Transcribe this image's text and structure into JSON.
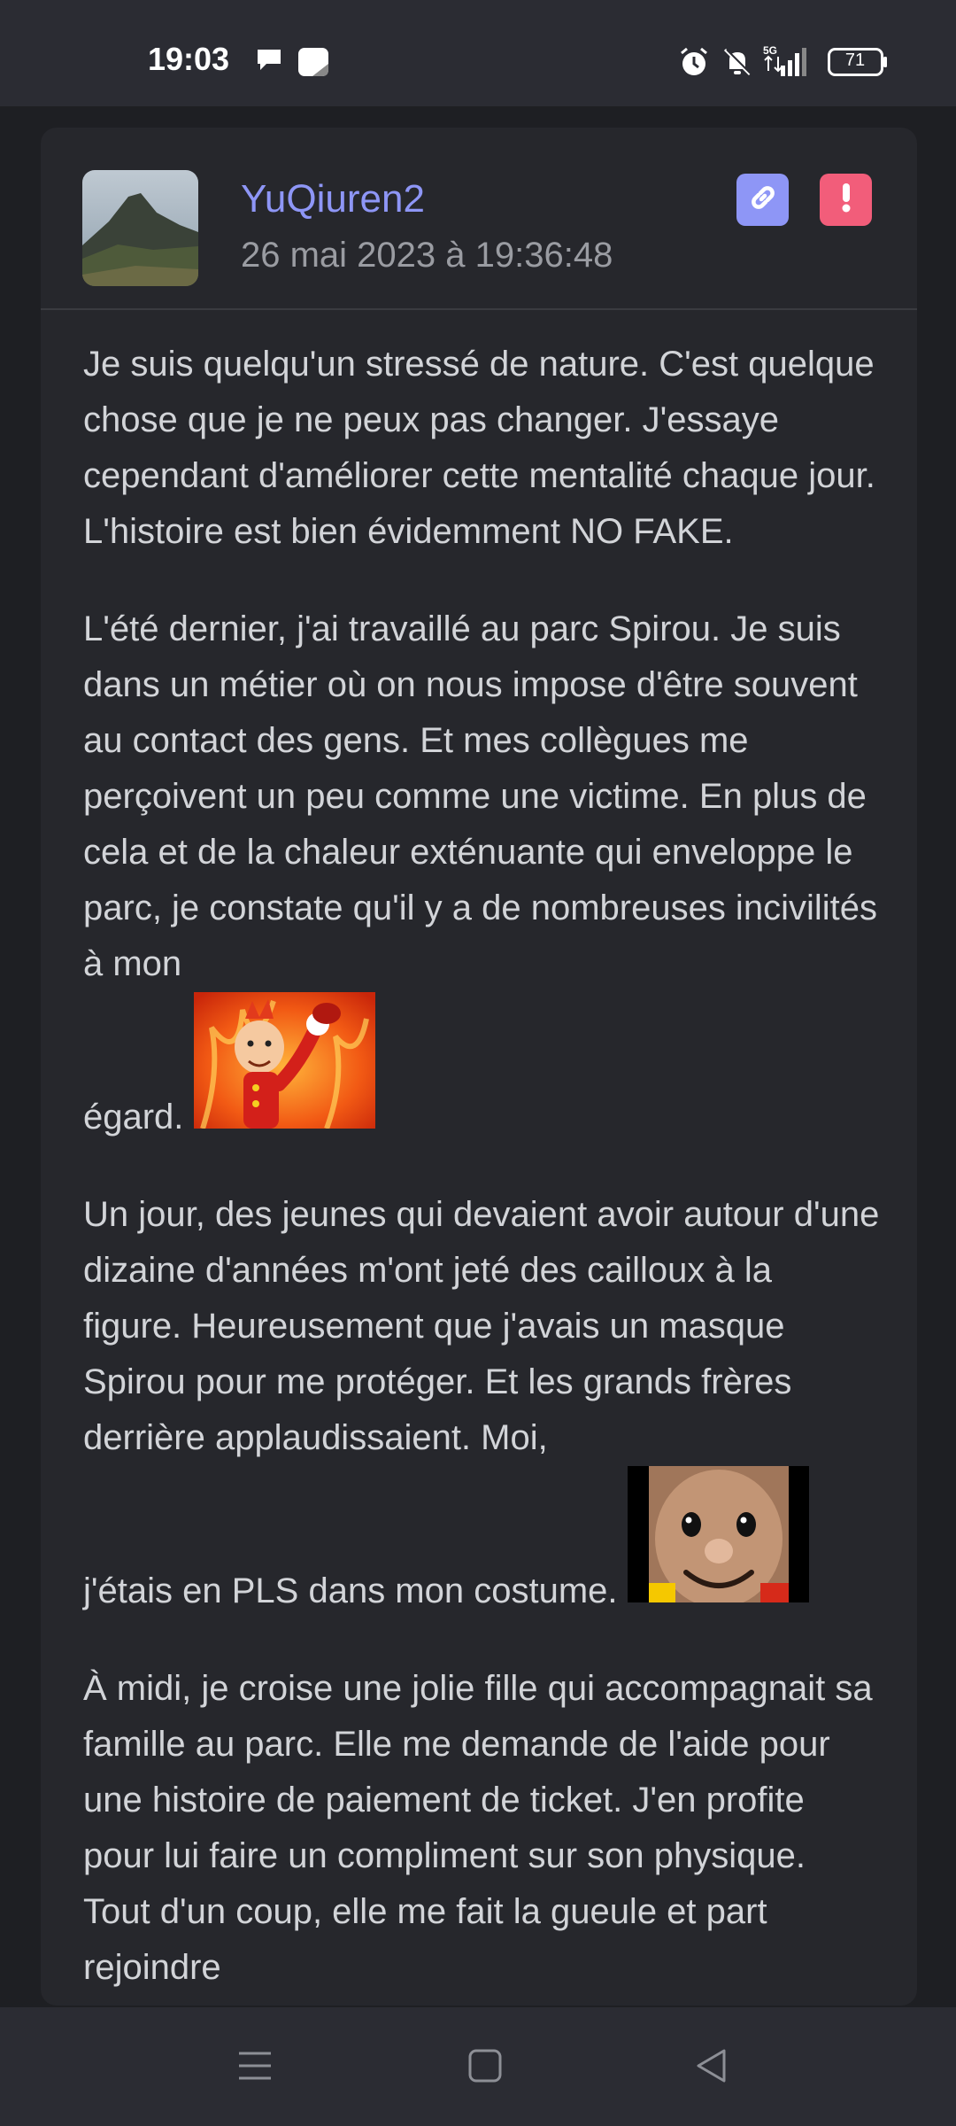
{
  "status_bar": {
    "time": "19:03",
    "battery": "71",
    "network": "5G",
    "icons": [
      "chat-bubble-icon",
      "app-notification-icon",
      "alarm-icon",
      "mute-icon",
      "signal-icon",
      "battery-icon"
    ]
  },
  "post": {
    "author": "YuQiuren2",
    "date": "26 mai 2023 à 19:36:48",
    "actions": [
      "link-icon",
      "report-icon"
    ],
    "paragraphs": [
      "Je suis quelqu'un stressé de nature. C'est quelque chose que je ne peux pas changer. J'essaye cependant d'améliorer cette mentalité chaque jour. L'histoire est bien évidemment NO FAKE.",
      "L'été dernier, j'ai travaillé au parc Spirou. Je suis dans un métier où on nous impose d'être souvent au contact des gens. Et mes collègues me perçoivent un peu comme une victime. En plus de cela et de la chaleur exténuante qui enveloppe le parc, je constate qu'il y a de nombreuses incivilités à mon",
      "égard.",
      "Un jour, des jeunes qui devaient avoir autour d'une dizaine d'années m'ont jeté des cailloux à la figure. Heureusement que j'avais un masque Spirou pour me protéger. Et les grands frères derrière applaudissaient. Moi,",
      "j'étais en PLS dans mon costume.",
      "À midi, je croise une jolie fille qui accompagnait sa famille au parc. Elle me demande de l'aide pour une histoire de paiement de ticket. J'en profite pour lui faire un compliment sur son physique. Tout d'un coup, elle me fait la gueule et part rejoindre"
    ]
  },
  "nav": {
    "icons": [
      "menu-icon",
      "home-icon",
      "back-icon"
    ]
  }
}
